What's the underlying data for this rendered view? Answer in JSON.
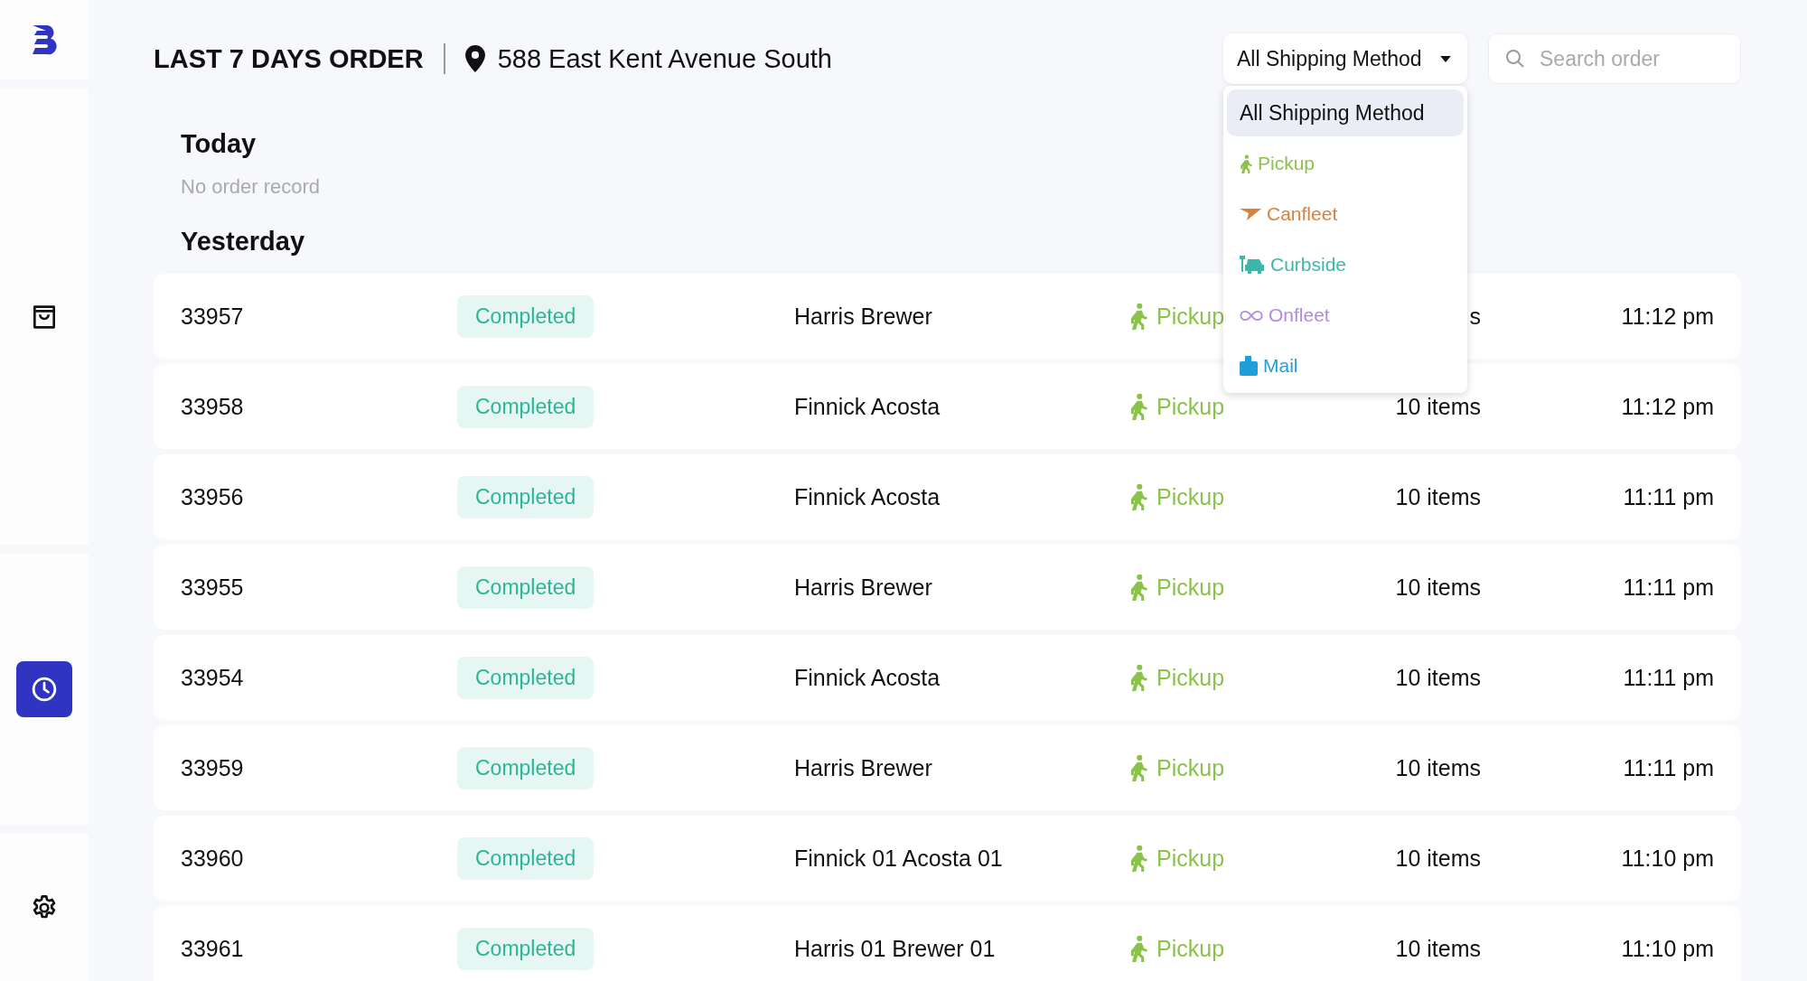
{
  "sidebar": {
    "items": [
      {
        "kind": "orders",
        "selected": false
      },
      {
        "kind": "history",
        "selected": true
      },
      {
        "kind": "settings",
        "selected": false
      }
    ]
  },
  "header": {
    "title": "LAST 7 DAYS ORDER",
    "location": "588 East Kent Avenue South"
  },
  "shipping_filter": {
    "value": "All Shipping Method",
    "expanded": true,
    "options": [
      {
        "label": "All Shipping Method",
        "kind": "all",
        "selected": true
      },
      {
        "label": "Pickup",
        "kind": "pickup",
        "color": "#8bc34a",
        "selected": false
      },
      {
        "label": "Canfleet",
        "kind": "canfleet",
        "color": "#d9803a",
        "selected": false
      },
      {
        "label": "Curbside",
        "kind": "curbside",
        "color": "#3bb8a8",
        "selected": false
      },
      {
        "label": "Onfleet",
        "kind": "onfleet",
        "color": "#b388e0",
        "selected": false
      },
      {
        "label": "Mail",
        "kind": "mail",
        "color": "#1f9fd8",
        "selected": false
      }
    ]
  },
  "search": {
    "placeholder": "Search order"
  },
  "sections": [
    {
      "title": "Today",
      "empty_text": "No order record"
    },
    {
      "title": "Yesterday",
      "orders": [
        {
          "id": "33957",
          "status": "Completed",
          "customer": "Harris Brewer",
          "method": "Pickup",
          "items": "s",
          "time": "11:12 pm"
        },
        {
          "id": "33958",
          "status": "Completed",
          "customer": "Finnick Acosta",
          "method": "Pickup",
          "items": "10 items",
          "time": "11:12 pm"
        },
        {
          "id": "33956",
          "status": "Completed",
          "customer": "Finnick Acosta",
          "method": "Pickup",
          "items": "10 items",
          "time": "11:11 pm"
        },
        {
          "id": "33955",
          "status": "Completed",
          "customer": "Harris Brewer",
          "method": "Pickup",
          "items": "10 items",
          "time": "11:11 pm"
        },
        {
          "id": "33954",
          "status": "Completed",
          "customer": "Finnick Acosta",
          "method": "Pickup",
          "items": "10 items",
          "time": "11:11 pm"
        },
        {
          "id": "33959",
          "status": "Completed",
          "customer": "Harris Brewer",
          "method": "Pickup",
          "items": "10 items",
          "time": "11:11 pm"
        },
        {
          "id": "33960",
          "status": "Completed",
          "customer": "Finnick 01 Acosta 01",
          "method": "Pickup",
          "items": "10 items",
          "time": "11:10 pm"
        },
        {
          "id": "33961",
          "status": "Completed",
          "customer": "Harris 01 Brewer 01",
          "method": "Pickup",
          "items": "10 items",
          "time": "11:10 pm"
        }
      ]
    }
  ]
}
